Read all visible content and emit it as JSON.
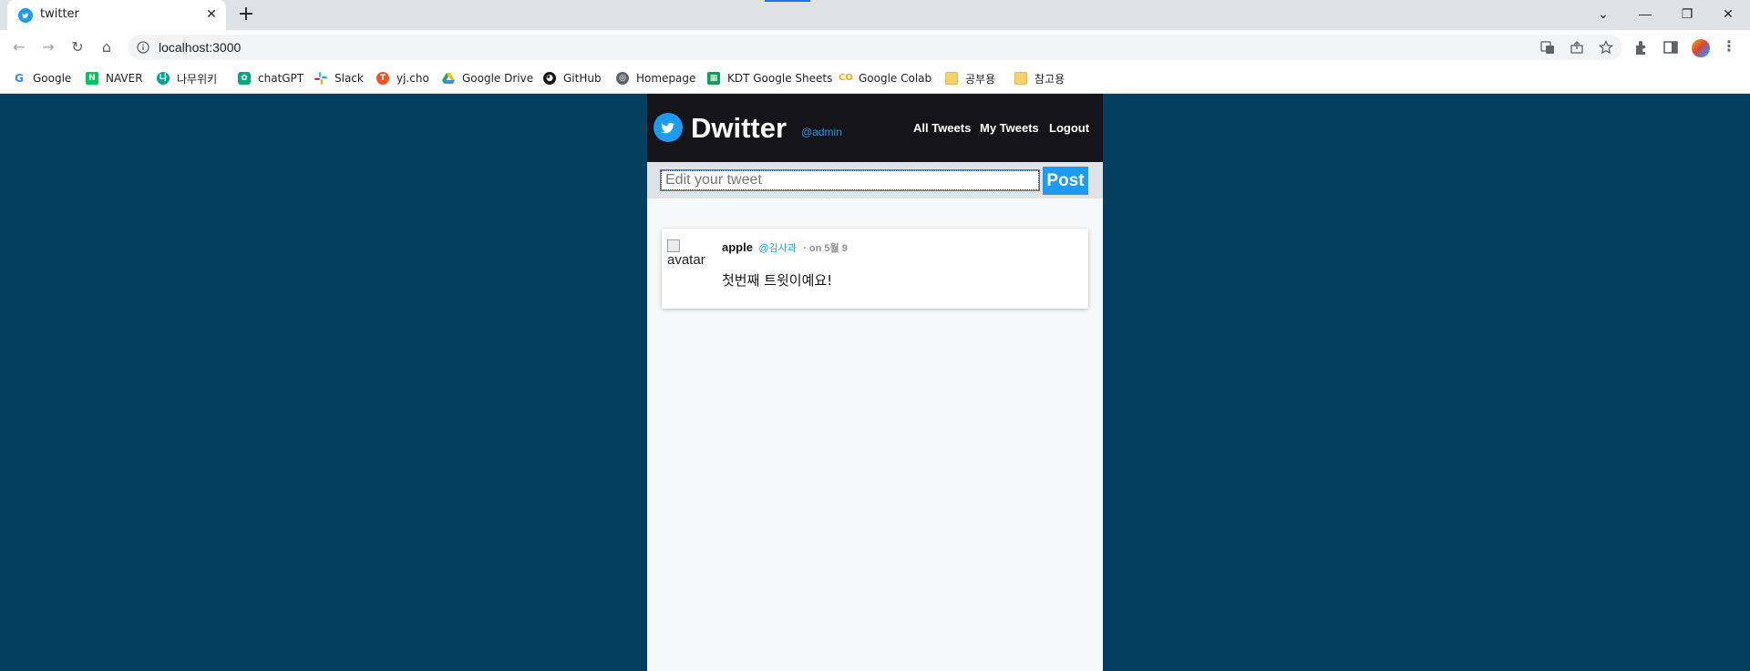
{
  "browser": {
    "tab": {
      "title": "twitter",
      "close_glyph": "✕"
    },
    "new_tab_glyph": "+",
    "window_controls": {
      "dropdown": "⌄",
      "minimize": "—",
      "restore": "❐",
      "close": "✕"
    },
    "nav": {
      "back": "←",
      "forward": "→",
      "reload": "↻",
      "home": "⌂"
    },
    "url": "localhost:3000",
    "bookmarks": [
      {
        "label": "Google",
        "icon": "google-icon",
        "color": "#4285f4"
      },
      {
        "label": "NAVER",
        "icon": "naver-icon",
        "color": "#03c75a"
      },
      {
        "label": "나무위키",
        "icon": "namuwiki-icon",
        "color": "#00a495"
      },
      {
        "label": "chatGPT",
        "icon": "chatgpt-icon",
        "color": "#10a37f"
      },
      {
        "label": "Slack",
        "icon": "slack-icon",
        "color": "#e01e5a"
      },
      {
        "label": "yj.cho",
        "icon": "tistory-icon",
        "color": "#eb531f"
      },
      {
        "label": "Google Drive",
        "icon": "google-drive-icon",
        "color": "#1fa463"
      },
      {
        "label": "GitHub",
        "icon": "github-icon",
        "color": "#181717"
      },
      {
        "label": "Homepage",
        "icon": "globe-icon",
        "color": "#5f6368"
      },
      {
        "label": "KDT Google Sheets",
        "icon": "google-sheets-icon",
        "color": "#0f9d58"
      },
      {
        "label": "Google Colab",
        "icon": "colab-icon",
        "color": "#f9ab00"
      },
      {
        "label": "공부용",
        "icon": "folder-icon",
        "color": "#f6d06a"
      },
      {
        "label": "참고용",
        "icon": "folder-icon",
        "color": "#f6d06a"
      }
    ]
  },
  "app": {
    "brand": "Dwitter",
    "handle": "@admin",
    "nav": {
      "all_tweets": "All Tweets",
      "my_tweets": "My Tweets",
      "logout": "Logout"
    },
    "composer": {
      "placeholder": "Edit your tweet",
      "post_label": "Post"
    },
    "tweets": [
      {
        "avatar_alt": "avatar",
        "name": "apple",
        "username": "@김사과",
        "date": "· on 5월 9",
        "text": "첫번째 트윗이예요!"
      }
    ]
  },
  "colors": {
    "page_bg": "#033f5e",
    "accent": "#1d9bf0",
    "header_bg": "#151519"
  }
}
